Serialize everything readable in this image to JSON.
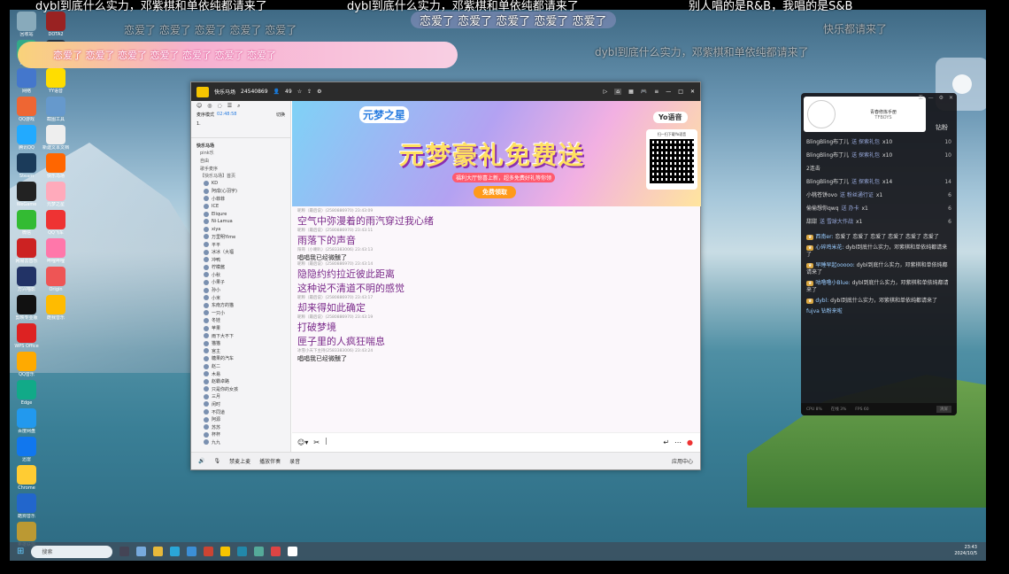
{
  "danmu": {
    "top1": "dybl到底什么实力，邓紫棋和单依纯都请来了",
    "top2": "dybl到底什么实力，邓紫棋和单依纯都请来了",
    "top3": "别人唱的是R&B，我唱的是S&B",
    "row2": "恋爱了 恋爱了 恋爱了 恋爱了 恋爱了",
    "row2b": "恋爱了",
    "row3": "dybl到底什么实力，邓紫棋和单依纯都请来了",
    "pinkbar": "恋爱了 恋爱了 恋爱了 恋爱了 恋爱了 恋爱了 恋爱了",
    "faint": "快乐都请来了"
  },
  "desktop_icons": [
    "回收站",
    "此电脑",
    "网络",
    "QQ游戏",
    "腾讯QQ",
    "Steam",
    "WeGame",
    "微信",
    "网易云音乐",
    "万兴喵影",
    "剪映专业版",
    "WPS Office",
    "QQ音乐",
    "Edge",
    "百度网盘",
    "迅雷",
    "Chrome",
    "酷狗音乐",
    "英雄联盟",
    "DOTA2",
    "UU加速器",
    "YY语音",
    "截图工具",
    "新建文本文档",
    "快乐马场",
    "元梦之星",
    "QQ飞车",
    "哔哩哔哩",
    "Origin",
    "酷我音乐"
  ],
  "yy": {
    "title": "快乐马场",
    "room_id": "24540869",
    "online": "49",
    "mode_label": "麦序模式",
    "timer": "02:48:58",
    "mode_btn": "切换",
    "first_on_mic": "1.",
    "channel_root": "快乐马场",
    "channels": [
      "pink乐",
      "自由",
      "歌手麦序",
      "【快乐马场】首页"
    ],
    "members": [
      "KD",
      "阿成(心羽宇)",
      "小菲菲",
      "ICE",
      "Eliqure",
      "Ni·Lamua",
      "xiya",
      "万里明Yime",
      "平平",
      "冰冰（大福",
      "冲鸭",
      "柠檬酱",
      "小秋",
      "小果子",
      "孙小",
      "小米",
      "东南方的猫",
      "一只小",
      "冬娃",
      "苹果",
      "雨下大不下",
      "猫猫",
      "宫主",
      "糖果的汽车",
      "赵二",
      "木易",
      "赵霸卓路",
      "只是你的女孩",
      "三月",
      "闲时",
      "不同道",
      "阿源",
      "苏苏",
      "杯杯",
      "九九"
    ],
    "banner": {
      "logo": "元梦之星",
      "title": "元梦豪礼免费送",
      "sub": "福利大厅惊喜上新，超多免费好礼等你领",
      "btn": "免费领取",
      "yo": "Yo语音",
      "qr_text": "扫一扫下载Yo语音"
    },
    "messages": [
      {
        "meta": "昵称（最后说）(2580886970) 23:43:09",
        "text": "空气中弥漫着的雨汽穿过我心绪",
        "style": "lyr"
      },
      {
        "meta": "昵称（最后说）(2580886970) 23:43:11",
        "text": "雨落下的声音",
        "style": "lyr"
      },
      {
        "meta": "阳哥（小喇叭）(2583383006) 23:43:13",
        "text": "唱唱我已经微醺了",
        "style": "dark"
      },
      {
        "meta": "昵称（最后说）(2580886970) 23:43:14",
        "text": "隐隐约约拉近彼此距离",
        "style": "lyr"
      },
      {
        "meta": "",
        "text": "这种说不清道不明的感觉",
        "style": "lyr"
      },
      {
        "meta": "昵称（最后说）(2580886970) 23:43:17",
        "text": "却来得如此确定",
        "style": "lyr"
      },
      {
        "meta": "昵称（最后说）(2580886970) 23:43:19",
        "text": "打破梦境",
        "style": "lyr"
      },
      {
        "meta": "",
        "text": "匣子里的人疯狂喘息",
        "style": "lyr"
      },
      {
        "meta": "冰雪小天下主持(2583383006) 23:43:24",
        "text": "唱唱我已经微醺了",
        "style": "dark"
      }
    ],
    "input_tools": "表情 / 截图",
    "bottom": {
      "mic": "禁麦上麦",
      "music": "播放伴奏",
      "record": "录音",
      "app": "应用中心"
    }
  },
  "side": {
    "header_title": "青春修炼手册",
    "header_sub": "TFBOYS",
    "tab": "钻粉",
    "gifts": [
      {
        "user": "BlingBling布丁儿",
        "act": "送 探索礼包",
        "n": "x10",
        "count": "10"
      },
      {
        "user": "BlingBling布丁儿",
        "act": "送 探索礼包",
        "n": "x10",
        "count": "10"
      },
      {
        "user": "2连击",
        "act": "",
        "n": "",
        "count": ""
      },
      {
        "user": "BlingBling布丁儿",
        "act": "送 探索礼包",
        "n": "x14",
        "count": "14"
      },
      {
        "user": "小桃苍饼ovo",
        "act": "送 粉丝通行证",
        "n": "x1",
        "count": "6"
      },
      {
        "user": "偷偷想你qwq",
        "act": "送 办卡",
        "n": "x1",
        "count": "6"
      },
      {
        "user": "甜甜",
        "act": "送 雪球大作战",
        "n": "x1",
        "count": "6"
      }
    ],
    "chats": [
      {
        "user": "西南er:",
        "text": "恋爱了 恋爱了 恋爱了 恋爱了 恋爱了 恋爱了"
      },
      {
        "user": "心碎鸡米花:",
        "text": "dybl到底什么实力，邓紫棋和单依纯都请来了"
      },
      {
        "user": "早睡早起ooooo:",
        "text": "dybl到底什么实力，邓紫棋和单依纯都请来了"
      },
      {
        "user": "咕噜噜小Blue:",
        "text": "dybl到底什么实力，邓紫棋和单依纯都请来了"
      },
      {
        "user": "dybl:",
        "text": "dybl到底什么实力，邓紫棋和单依纯都请来了"
      }
    ],
    "entry": "fujva 钻粉来啦",
    "foot": [
      "CPU 8%",
      "在线 3%",
      "FPS 60"
    ],
    "foot_btn": "清屏"
  },
  "taskbar": {
    "search": "搜索",
    "time": "23:43",
    "date": "2024/10/5"
  }
}
